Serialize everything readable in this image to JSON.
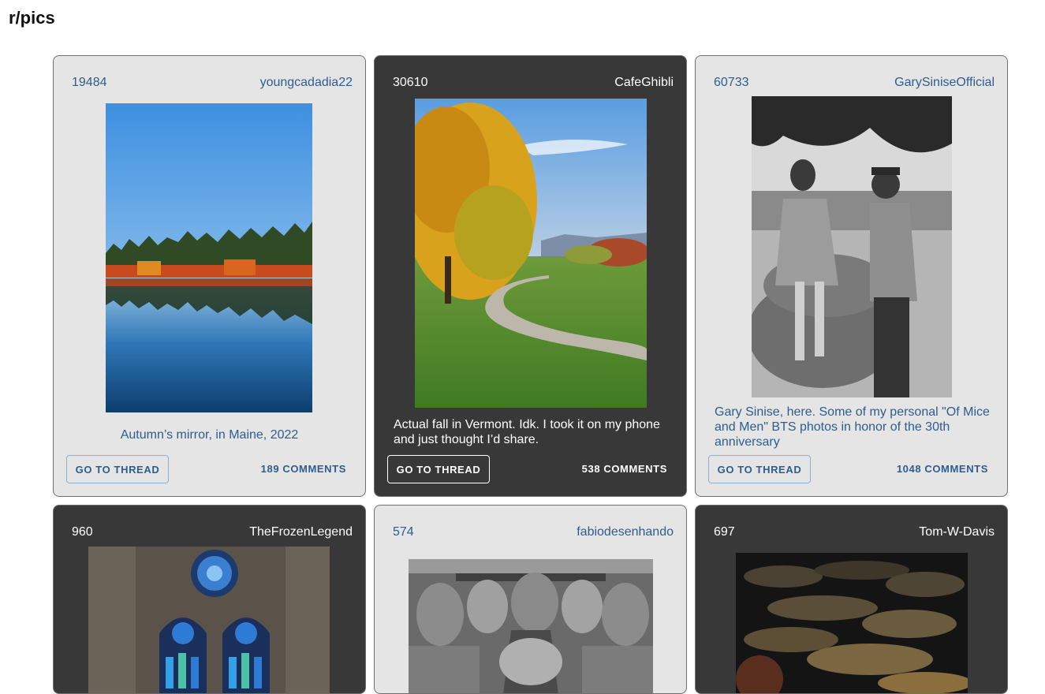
{
  "page": {
    "title": "r/pics"
  },
  "posts": [
    {
      "score": "19484",
      "author": "youngcadadia22",
      "caption": "Autumn’s mirror, in Maine, 2022",
      "button": "GO TO THREAD",
      "comments": "189 COMMENTS"
    },
    {
      "score": "30610",
      "author": "CafeGhibli",
      "caption": "Actual fall in Vermont. Idk. I took it on my phone and just thought I’d share.",
      "button": "GO TO THREAD",
      "comments": "538 COMMENTS"
    },
    {
      "score": "60733",
      "author": "GarySiniseOfficial",
      "caption": "Gary Sinise, here. Some of my personal \"Of Mice and Men\" BTS photos in honor of the 30th anniversary",
      "button": "GO TO THREAD",
      "comments": "1048 COMMENTS"
    },
    {
      "score": "960",
      "author": "TheFrozenLegend"
    },
    {
      "score": "574",
      "author": "fabiodesenhando"
    },
    {
      "score": "697",
      "author": "Tom-W-Davis"
    }
  ]
}
